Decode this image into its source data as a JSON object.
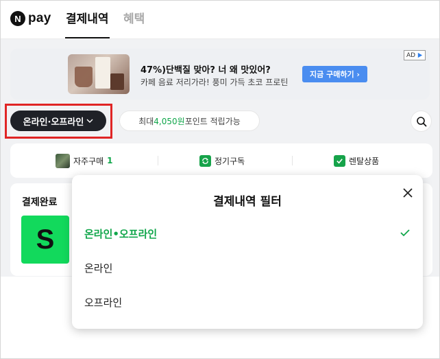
{
  "nav": {
    "logo_letter": "N",
    "logo_text": "pay",
    "tabs": [
      {
        "label": "결제내역",
        "active": true
      },
      {
        "label": "혜택",
        "active": false
      }
    ]
  },
  "ad": {
    "title": "47%)단백질 맞아? 너 왜 맛있어?",
    "subtitle": "카페 음료 저리가라! 풍미 가득 초코 프로틴",
    "cta_label": "지금 구매하기 ›",
    "badge": "AD"
  },
  "filter": {
    "selected_label": "온라인·오프라인",
    "point_prefix": "최대 ",
    "point_amount": "4,050원",
    "point_suffix": " 포인트 적립가능"
  },
  "quick_menu": [
    {
      "label": "자주구매",
      "count": "1",
      "icon": "product-thumbnail"
    },
    {
      "label": "정기구독",
      "icon": "refresh-icon"
    },
    {
      "label": "렌탈상품",
      "icon": "check-box-icon"
    }
  ],
  "payment": {
    "status": "결제완료",
    "merchant_initial": "S"
  },
  "modal": {
    "title": "결제내역 필터",
    "options": [
      {
        "label": "온라인•오프라인",
        "selected": true
      },
      {
        "label": "온라인",
        "selected": false
      },
      {
        "label": "오프라인",
        "selected": false
      }
    ]
  },
  "colors": {
    "accent_green": "#10a64a",
    "highlight_red": "#e02525",
    "cta_blue": "#4a8df0",
    "pill_dark": "#1f2127"
  }
}
